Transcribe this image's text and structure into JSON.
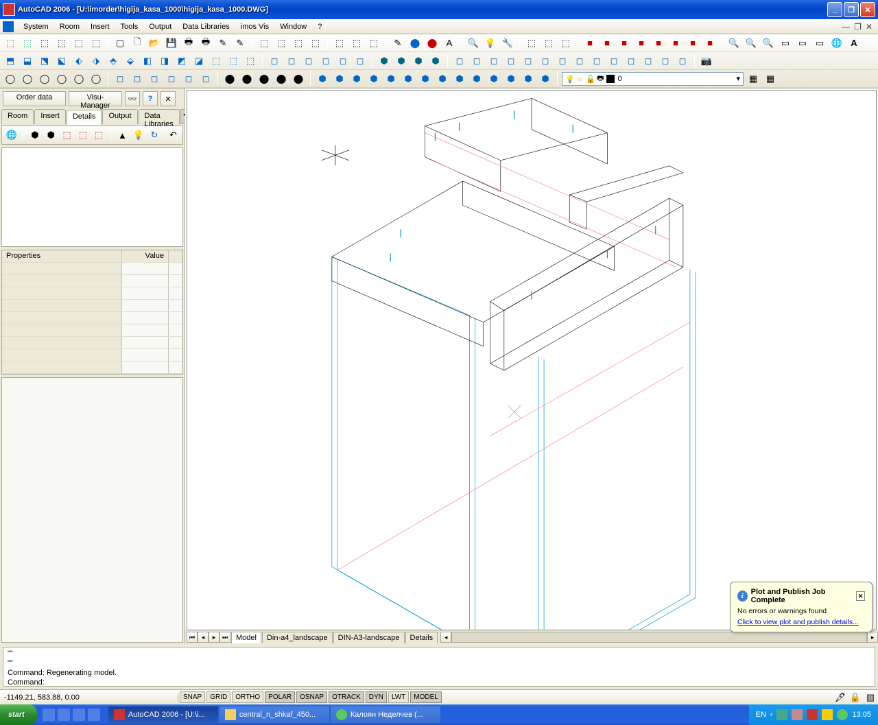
{
  "title": "AutoCAD 2006 - [U:\\imorder\\higija_kasa_1000\\higija_kasa_1000.DWG]",
  "menus": [
    "System",
    "Room",
    "Insert",
    "Tools",
    "Output",
    "Data Libraries",
    "imos Vis",
    "Window",
    "?"
  ],
  "layer": {
    "name": "0"
  },
  "leftpanel": {
    "btns": {
      "order": "Order data",
      "visu": "Visu-Manager"
    },
    "tabs": [
      "Room",
      "Insert",
      "Details",
      "Output",
      "Data Libraries"
    ],
    "active_tab": 2,
    "prop_headers": {
      "c1": "Properties",
      "c2": "Value"
    }
  },
  "view_tabs": [
    "Model",
    "Din-a4_landscape",
    "DIN-A3-landscape",
    "Details"
  ],
  "view_active": 0,
  "cmd_lines": [
    "\"\"",
    "\"\"",
    "Command: Regenerating model.",
    "Command:"
  ],
  "status": {
    "coords": "-1149.21, 583.88, 0.00",
    "btns": [
      "SNAP",
      "GRID",
      "ORTHO",
      "POLAR",
      "OSNAP",
      "OTRACK",
      "DYN",
      "LWT",
      "MODEL"
    ],
    "btn_active": [
      false,
      false,
      false,
      true,
      true,
      true,
      true,
      false,
      true
    ]
  },
  "tasks": {
    "start": "start",
    "items": [
      {
        "label": "AutoCAD 2006 - [U:\\i...",
        "active": true,
        "color": "#c33"
      },
      {
        "label": "central_n_shkaf_450...",
        "active": false,
        "color": "#f5d060"
      },
      {
        "label": "Калоян Неделчев (...",
        "active": false,
        "color": "#5bc860"
      }
    ],
    "lang": "EN",
    "time": "13:05"
  },
  "notif": {
    "title": "Plot and Publish Job Complete",
    "body": "No errors or warnings found",
    "link": "Click to view plot and publish details..."
  }
}
